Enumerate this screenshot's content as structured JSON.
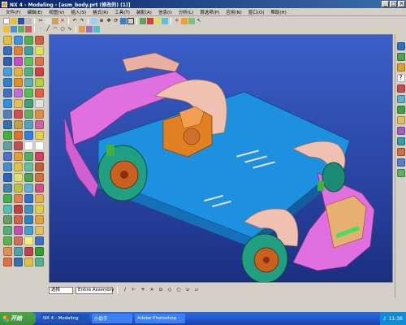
{
  "window": {
    "title": "NX 4 - Modeling - [asm_body.prt  (修改的)      (1)]",
    "buttons": [
      "_",
      "□",
      "×"
    ]
  },
  "menu": {
    "items": [
      "文件(F)",
      "编辑(E)",
      "视图(V)",
      "插入(S)",
      "格式(R)",
      "工具(T)",
      "装配(A)",
      "信息(I)",
      "分析(L)",
      "首选项(P)",
      "应用(N)",
      "窗口(O)",
      "帮助(H)"
    ]
  },
  "statusbar": {
    "filter_value": "选择",
    "assembly_value": "Entire Assembly"
  },
  "taskbar": {
    "start_label": "开始",
    "tasks": [
      "NX 4 - Modeling",
      "小助手",
      "Adobe Photoshop"
    ],
    "clock": "11:36"
  },
  "colors": {
    "viewport_top": "#3a5fc8",
    "chassis": "#1e90e0",
    "body_panels": "#e070e0",
    "fenders": "#f0c0b0",
    "wheels": "#20a080",
    "rims": "#c86020",
    "engine": "#e08020"
  }
}
